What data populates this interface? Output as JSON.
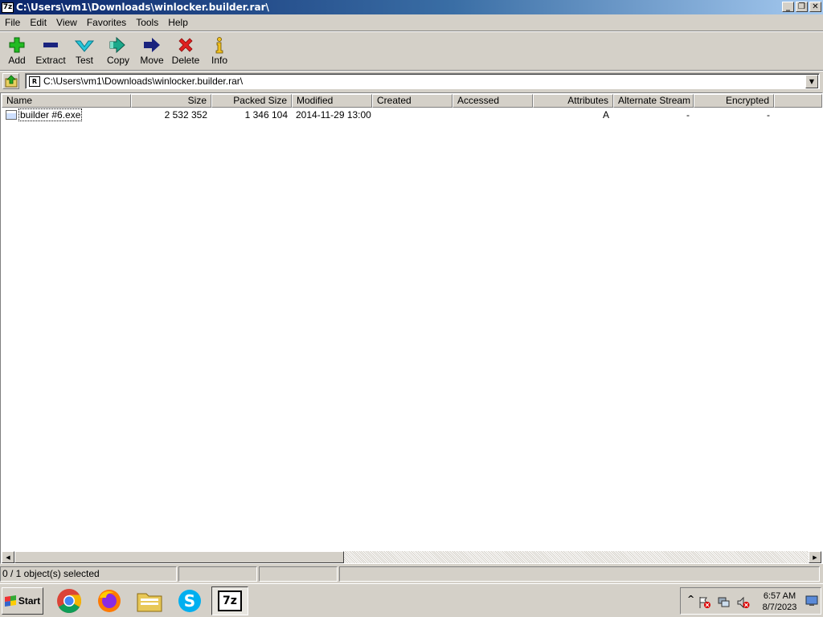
{
  "window": {
    "icon_label": "7z",
    "title": "C:\\Users\\vm1\\Downloads\\winlocker.builder.rar\\",
    "controls": {
      "minimize": "_",
      "restore": "❐",
      "close": "✕"
    }
  },
  "menu": [
    "File",
    "Edit",
    "View",
    "Favorites",
    "Tools",
    "Help"
  ],
  "toolbar": [
    {
      "label": "Add",
      "icon": "plus-icon",
      "color": "#22bb22"
    },
    {
      "label": "Extract",
      "icon": "minus-icon",
      "color": "#1a237e"
    },
    {
      "label": "Test",
      "icon": "checkmark-icon",
      "color": "#26c6da"
    },
    {
      "label": "Copy",
      "icon": "arrow-right-double-icon",
      "color": "#1aa88a"
    },
    {
      "label": "Move",
      "icon": "arrow-right-icon",
      "color": "#1a237e"
    },
    {
      "label": "Delete",
      "icon": "x-icon",
      "color": "#e02020"
    },
    {
      "label": "Info",
      "icon": "info-icon",
      "color": "#f0c020"
    }
  ],
  "address": {
    "path": "C:\\Users\\vm1\\Downloads\\winlocker.builder.rar\\",
    "icon_label": "R"
  },
  "columns": [
    "Name",
    "Size",
    "Packed Size",
    "Modified",
    "Created",
    "Accessed",
    "Attributes",
    "Alternate Stream",
    "Encrypted"
  ],
  "rows": [
    {
      "name": "builder #6.exe",
      "size": "2 532 352",
      "packed_size": "1 346 104",
      "modified": "2014-11-29 13:00",
      "created": "",
      "accessed": "",
      "attributes": "A",
      "alternate_stream": "-",
      "encrypted": "-"
    }
  ],
  "status": {
    "selection": "0 / 1 object(s) selected",
    "panel2": "",
    "panel3": "",
    "panel4": ""
  },
  "taskbar": {
    "start_label": "Start",
    "apps": [
      "chrome-icon",
      "firefox-icon",
      "file-explorer-icon",
      "skype-icon",
      "7zip-icon"
    ],
    "active_app_label": "7z",
    "tray_expand": "^",
    "clock_time": "6:57 AM",
    "clock_date": "8/7/2023"
  }
}
